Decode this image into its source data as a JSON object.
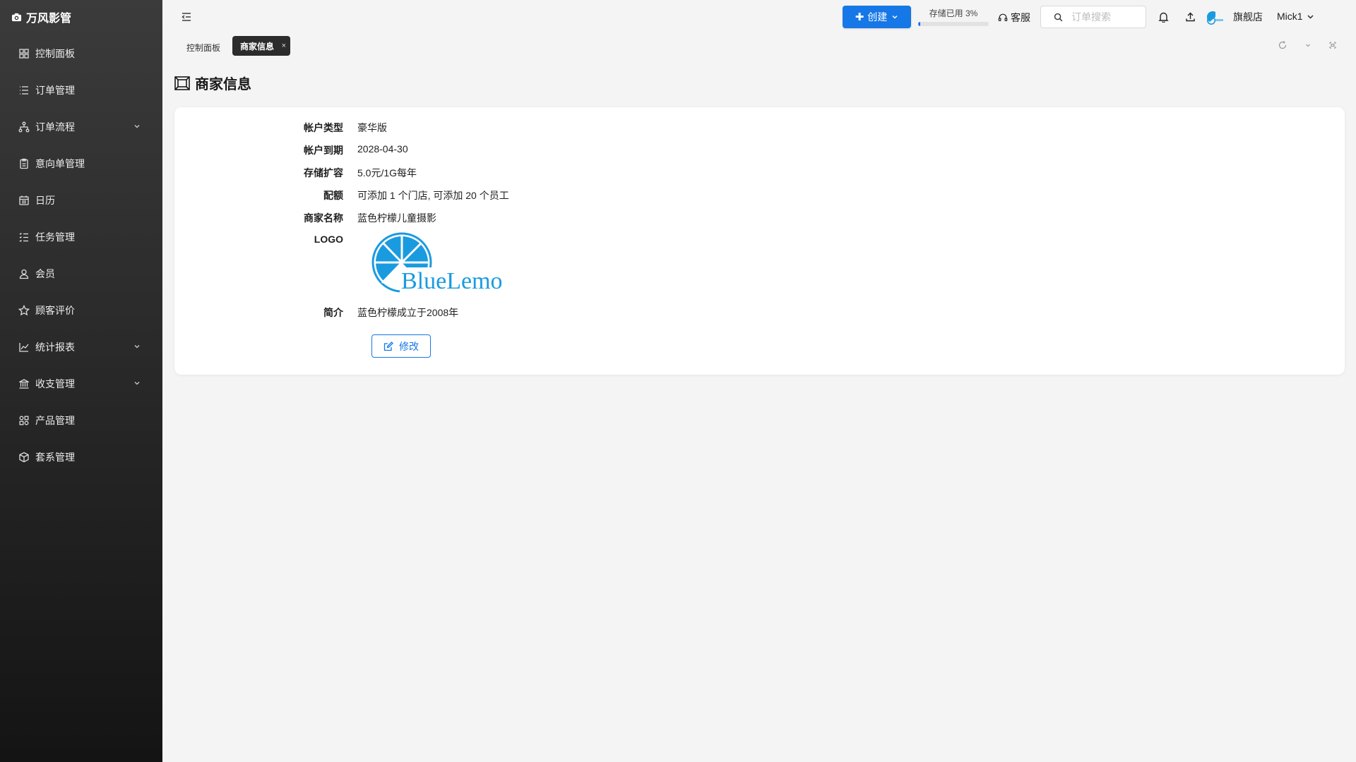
{
  "app": {
    "name": "万风影管"
  },
  "sidebar": {
    "items": [
      {
        "label": "控制面板",
        "icon": "grid-icon",
        "has_children": false
      },
      {
        "label": "订单管理",
        "icon": "list-icon",
        "has_children": false
      },
      {
        "label": "订单流程",
        "icon": "flow-icon",
        "has_children": true
      },
      {
        "label": "意向单管理",
        "icon": "clipboard-icon",
        "has_children": false
      },
      {
        "label": "日历",
        "icon": "calendar-icon",
        "has_children": false
      },
      {
        "label": "任务管理",
        "icon": "tasks-icon",
        "has_children": false
      },
      {
        "label": "会员",
        "icon": "user-icon",
        "has_children": false
      },
      {
        "label": "顾客评价",
        "icon": "star-icon",
        "has_children": false
      },
      {
        "label": "统计报表",
        "icon": "chart-icon",
        "has_children": true
      },
      {
        "label": "收支管理",
        "icon": "bank-icon",
        "has_children": true
      },
      {
        "label": "产品管理",
        "icon": "apps-icon",
        "has_children": false
      },
      {
        "label": "套系管理",
        "icon": "box-icon",
        "has_children": false
      }
    ]
  },
  "topbar": {
    "create_label": "创建",
    "storage_label": "存储已用 3%",
    "storage_used_percent": 3,
    "service_label": "客服",
    "search_placeholder": "订单搜索",
    "store_label": "旗舰店",
    "user_name": "Mick1"
  },
  "tabs": [
    {
      "label": "控制面板",
      "active": false
    },
    {
      "label": "商家信息",
      "active": true,
      "close": "×"
    }
  ],
  "page": {
    "title": "商家信息",
    "fields": {
      "account_type": {
        "label": "帐户类型",
        "value": "豪华版"
      },
      "expiry": {
        "label": "帐户到期",
        "value": "2028-04-30"
      },
      "storage": {
        "label": "存储扩容",
        "value": "5.0元/1G每年"
      },
      "quota": {
        "label": "配额",
        "value": "可添加 1 个门店, 可添加 20 个员工"
      },
      "merchant_name": {
        "label": "商家名称",
        "value": "蓝色柠檬儿童摄影"
      },
      "logo": {
        "label": "LOGO",
        "logo_text": "BlueLemon"
      },
      "intro": {
        "label": "简介",
        "value": "蓝色柠檬成立于2008年"
      }
    },
    "edit_label": "修改"
  },
  "colors": {
    "primary": "#1677e6",
    "logo_blue": "#1a9be0",
    "sidebar_top": "#3b3b3b",
    "sidebar_bottom": "#141414"
  }
}
